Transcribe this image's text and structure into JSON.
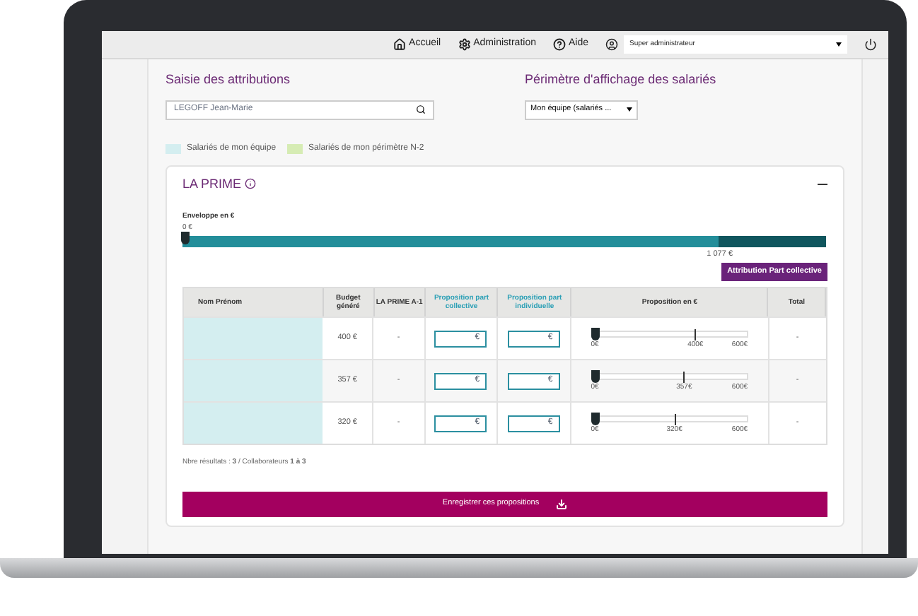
{
  "nav": {
    "items": [
      {
        "label": "Accueil",
        "kind": "home"
      },
      {
        "label": "Administration",
        "kind": "settings"
      },
      {
        "label": "Aide",
        "kind": "help"
      }
    ],
    "user_select": {
      "value": "Super administrateur"
    }
  },
  "attributions": {
    "title": "Saisie des attributions",
    "search": {
      "value": "LEGOFF Jean-Marie"
    }
  },
  "perimetre": {
    "title": "Périmètre d'affichage des salariés",
    "select": {
      "value": "Mon équipe (salariés ..."
    }
  },
  "legend": [
    {
      "label": "Salariés de mon équipe",
      "color": "#d4eef0"
    },
    {
      "label": "Salariés de mon périmètre N-2",
      "color": "#d6ecb4"
    }
  ],
  "card": {
    "title": "LA PRIME",
    "expanded": true,
    "envelope": {
      "label": "Enveloppe en €",
      "handle": {
        "level": 0,
        "label": "0 €"
      },
      "allocated": {
        "level": 0.833,
        "label": "1 077 €"
      }
    },
    "action_button": "Attribution Part collective",
    "table": {
      "columns": [
        {
          "label": "Nom Prénom",
          "highlight": false
        },
        {
          "label": "Budget généré",
          "highlight": false
        },
        {
          "label": "LA PRIME A-1",
          "highlight": false
        },
        {
          "label": "Proposition part collective",
          "highlight": true
        },
        {
          "label": "Proposition part individuelle",
          "highlight": true
        },
        {
          "label": "Proposition en €",
          "highlight": false
        },
        {
          "label": "Total",
          "highlight": false
        }
      ],
      "rows": [
        {
          "color": "#d4eef0",
          "budget": "400 €",
          "prime": "-",
          "collective": "€",
          "individuelle": "€",
          "handle": {
            "level": 0
          },
          "min": "0€",
          "marker": {
            "level": 0.667,
            "label": "400€"
          },
          "max": "600€",
          "total": "-"
        },
        {
          "color": "#d4eef0",
          "budget": "357 €",
          "prime": "-",
          "collective": "€",
          "individuelle": "€",
          "handle": {
            "level": 0
          },
          "min": "0€",
          "marker": {
            "level": 0.595,
            "label": "357€"
          },
          "max": "600€",
          "total": "-"
        },
        {
          "color": "#d4eef0",
          "budget": "320 €",
          "prime": "-",
          "collective": "€",
          "individuelle": "€",
          "handle": {
            "level": 0
          },
          "min": "0€",
          "marker": {
            "level": 0.533,
            "label": "320€"
          },
          "max": "600€",
          "total": "-"
        }
      ]
    },
    "results": "Nbre résultats : **3** / Collaborateurs **1 à 3**",
    "save_button": "Enregistrer ces propositions"
  }
}
